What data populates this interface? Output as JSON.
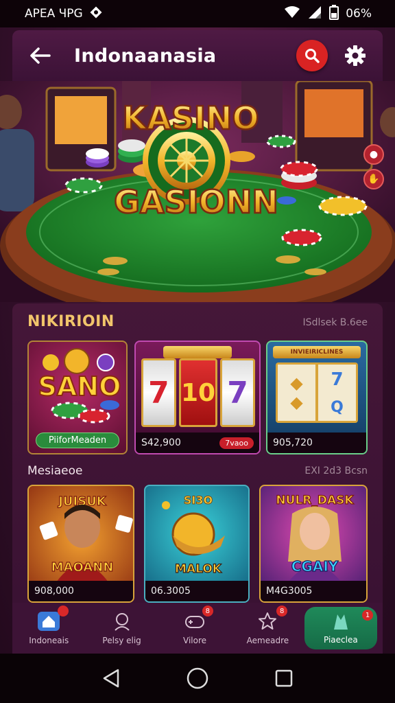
{
  "status": {
    "app_name": "APEA ЧPG",
    "battery": "06%",
    "icons": [
      "android-icon",
      "wifi-icon",
      "signal-icon",
      "battery-icon"
    ]
  },
  "appbar": {
    "title": "Indonaanasia",
    "icons": [
      "back-arrow-icon",
      "search-icon",
      "gear-icon"
    ],
    "accent": "#d92323"
  },
  "hero": {
    "logo_line1": "KASINO",
    "logo_line2": "GASIONN",
    "side_buttons": [
      "chip-icon",
      "hand-icon"
    ]
  },
  "section1": {
    "title": "NIKIRIOIN",
    "link": "ISdlsek B.6ee",
    "cards": [
      {
        "title": "SANO",
        "caption": "PiiforMeaden"
      },
      {
        "reels": [
          "7",
          "10",
          "7"
        ],
        "amount": "S42,900",
        "tag": "7vaoo"
      },
      {
        "banner": "INVIEIRICLINES",
        "amount": "905,720"
      }
    ]
  },
  "section2": {
    "title": "Mesiaeoe",
    "link": "EXI 2d3 Bcsn",
    "cards": [
      {
        "top": "JUISUK",
        "bottom": "MAOANN",
        "amount": "908,000"
      },
      {
        "top": "SI3O",
        "bottom": "MALOK",
        "amount": "06.3005"
      },
      {
        "top": "NULR_DASK",
        "bottom": "CGAIY",
        "amount": "M4G3005"
      }
    ]
  },
  "bottom_nav": [
    {
      "label": "Indoneais",
      "icon": "home-icon",
      "badge": ""
    },
    {
      "label": "Pelsy elig",
      "icon": "profile-icon",
      "badge": ""
    },
    {
      "label": "Vilore",
      "icon": "gamepad-icon",
      "badge": "8"
    },
    {
      "label": "Aemeadre",
      "icon": "star-icon",
      "badge": "8"
    },
    {
      "label": "Piaeclea",
      "icon": "tower-icon",
      "badge": "1"
    }
  ],
  "system_nav": [
    "back-triangle-icon",
    "home-circle-icon",
    "recents-square-icon"
  ]
}
